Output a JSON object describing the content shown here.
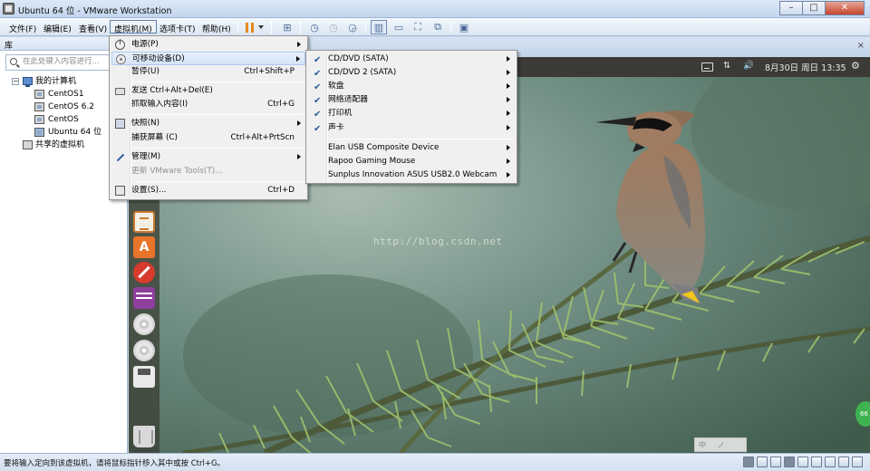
{
  "window": {
    "title": "Ubuntu 64 位 - VMware Workstation",
    "controls": {
      "minimize": "–",
      "maximize": "□",
      "close": "✕"
    }
  },
  "menubar": {
    "items": [
      "文件(F)",
      "编辑(E)",
      "查看(V)",
      "虚拟机(M)",
      "选项卡(T)",
      "帮助(H)"
    ],
    "active": "虚拟机(M)",
    "toolbar_icons": [
      "pause-icon",
      "send-ctrl-alt-del-icon",
      "snapshot-icon",
      "revert-snapshot-icon",
      "snapshot-manager-icon",
      "library-view-icon",
      "console-view-icon",
      "fullscreen-icon",
      "unity-icon",
      "thumbnail-icon"
    ]
  },
  "library": {
    "title": "库",
    "close": "×",
    "search_placeholder": "在此处键入内容进行...",
    "tree": {
      "root": {
        "label": "我的计算机",
        "toggle": "−"
      },
      "vms": [
        "CentOS1",
        "CentOS 6.2",
        "CentOS",
        "Ubuntu 64 位"
      ],
      "shared": "共享的虚拟机"
    }
  },
  "tabstrip": {
    "close": "×"
  },
  "guest": {
    "topbar": {
      "network_icon": "⇅",
      "volume_icon": "🔊",
      "datetime": "8月30日 周日 13:35",
      "gear_icon": "⚙"
    },
    "launcher_icons": [
      "libreoffice-impress-icon",
      "ubuntu-software-center-icon",
      "system-settings-icon",
      "dash-icon",
      "cd-drive-icon",
      "cd-drive-2-icon",
      "save-icon",
      "trash-icon"
    ],
    "appstore_letter": "A",
    "watermark": "http://blog.csdn.net",
    "ime_bar": "中 ノ 半",
    "green_badge": "66"
  },
  "vm_menu": {
    "items": [
      {
        "label": "电源(P)",
        "shortcut": "",
        "submenu": true,
        "icon": "power-icon"
      },
      {
        "label": "可移动设备(D)",
        "shortcut": "",
        "submenu": true,
        "icon": "removable-devices-icon",
        "highlighted": true
      },
      {
        "label": "暂停(U)",
        "shortcut": "Ctrl+Shift+P",
        "submenu": false
      },
      {
        "label": "发送 Ctrl+Alt+Del(E)",
        "shortcut": "",
        "submenu": false,
        "icon": "keyboard-icon"
      },
      {
        "label": "抓取输入内容(I)",
        "shortcut": "Ctrl+G",
        "submenu": false
      },
      {
        "label": "快照(N)",
        "shortcut": "",
        "submenu": true,
        "icon": "snapshot-icon"
      },
      {
        "label": "捕获屏幕 (C)",
        "shortcut": "Ctrl+Alt+PrtScn",
        "submenu": false
      },
      {
        "label": "管理(M)",
        "shortcut": "",
        "submenu": true,
        "icon": "wrench-icon"
      },
      {
        "label": "更新 VMware Tools(T)...",
        "shortcut": "",
        "submenu": false,
        "disabled": true
      },
      {
        "label": "设置(S)...",
        "shortcut": "Ctrl+D",
        "submenu": false,
        "icon": "settings-icon"
      }
    ]
  },
  "devices_menu": {
    "items": [
      {
        "label": "CD/DVD (SATA)",
        "checked": true
      },
      {
        "label": "CD/DVD 2 (SATA)",
        "checked": true
      },
      {
        "label": "软盘",
        "checked": true
      },
      {
        "label": "网络适配器",
        "checked": true
      },
      {
        "label": "打印机",
        "checked": true
      },
      {
        "label": "声卡",
        "checked": true
      },
      {
        "label": "Elan USB Composite Device",
        "checked": false
      },
      {
        "label": "Rapoo Gaming Mouse",
        "checked": false
      },
      {
        "label": "Sunplus Innovation ASUS USB2.0 Webcam",
        "checked": false
      }
    ]
  },
  "statusbar": {
    "text": "要将输入定向到该虚拟机，请将鼠标指针移入其中或按 Ctrl+G。",
    "tray_icons": [
      "hdd-icon",
      "cd-icon",
      "cd2-icon",
      "floppy-icon",
      "network-icon",
      "usb-icon",
      "printer-icon",
      "sound-icon",
      "message-icon"
    ]
  },
  "colors": {
    "titlebar": "#c3d6ee",
    "menu_highlight": "#d4e4f6",
    "ubuntu_panel": "#3b3a36",
    "check": "#2e5d9c",
    "close_button": "#c4452c"
  }
}
